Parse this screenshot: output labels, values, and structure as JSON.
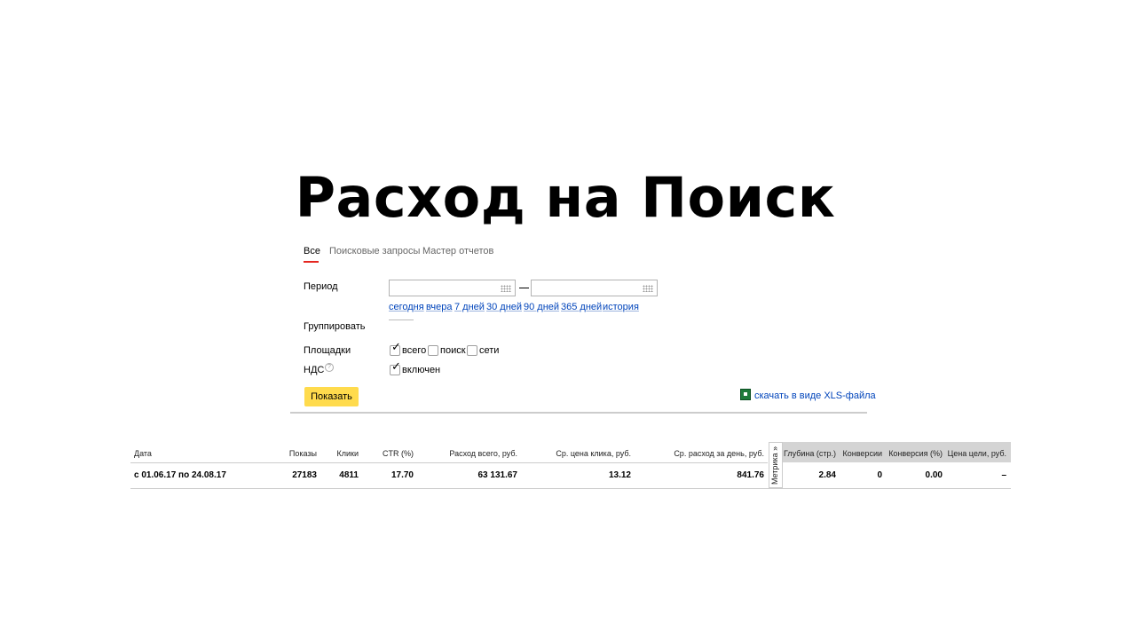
{
  "slide": {
    "title": "Расход на Поиск"
  },
  "tabs": [
    {
      "label": "Все",
      "active": true
    },
    {
      "label": "Поисковые запросы",
      "active": false
    },
    {
      "label": "Мастер отчетов",
      "active": false
    }
  ],
  "form": {
    "period_label": "Период",
    "period_from": "",
    "period_to": "",
    "period_links": [
      "сегодня",
      "вчера",
      "7 дней",
      "30 дней",
      "90 дней",
      "365 дней",
      "история"
    ],
    "group_label": "Группировать",
    "platforms_label": "Площадки",
    "platforms": [
      {
        "label": "всего",
        "checked": true
      },
      {
        "label": "поиск",
        "checked": false
      },
      {
        "label": "сети",
        "checked": false
      }
    ],
    "vat_label": "НДС",
    "vat_help": "?",
    "vat_option": {
      "label": "включен",
      "checked": true
    },
    "submit_label": "Показать",
    "xls_link": "скачать в виде XLS-файла"
  },
  "table": {
    "columns": [
      "Дата",
      "Показы",
      "Клики",
      "CTR (%)",
      "Расход всего, руб.",
      "Ср. цена клика, руб.",
      "Ср. расход за день, руб."
    ],
    "metrika_tab": "Метрика »",
    "metrika_columns": [
      "Глубина (стр.)",
      "Конверсии",
      "Конверсия (%)",
      "Цена цели, руб."
    ],
    "row": {
      "date": "с 01.06.17 по 24.08.17",
      "impressions": "27183",
      "clicks": "4811",
      "ctr": "17.70",
      "cost_total": "63 131.67",
      "avg_cpc": "13.12",
      "avg_daily": "841.76",
      "depth": "2.84",
      "conversions": "0",
      "conversion_rate": "0.00",
      "goal_cost": "–"
    }
  },
  "colors": {
    "accent_red": "#e52620",
    "button_yellow": "#ffdb4d",
    "link_blue": "#0044bb"
  }
}
